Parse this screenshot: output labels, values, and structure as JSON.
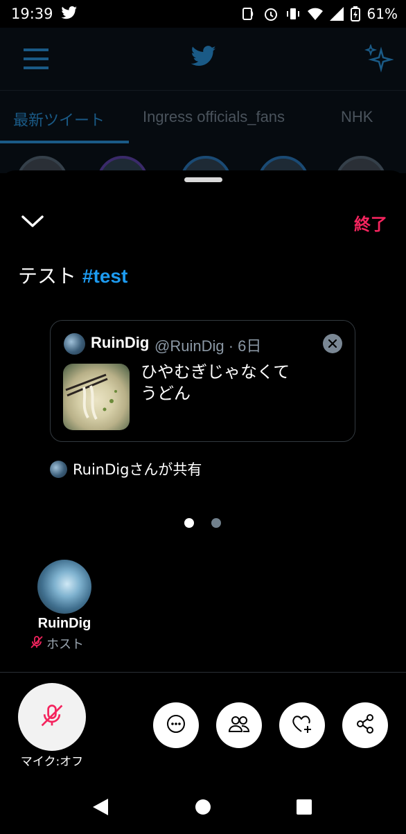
{
  "status_bar": {
    "time": "19:39",
    "battery": "61%"
  },
  "tabs": [
    {
      "label": "最新ツイート",
      "active": true
    },
    {
      "label": "Ingress officials_fans",
      "active": false
    },
    {
      "label": "NHK",
      "active": false
    }
  ],
  "space": {
    "title_text": "テスト",
    "title_hashtag": "#test",
    "end_label": "終了"
  },
  "pinned_tweet": {
    "name": "RuinDig",
    "handle_time": "@RuinDig · 6日",
    "text_line1": "ひやむぎじゃなくて",
    "text_line2": "うどん",
    "shared_by": "RuinDigさんが共有"
  },
  "carousel": {
    "pages": 2,
    "current": 1
  },
  "host": {
    "name": "RuinDig",
    "role": "ホスト"
  },
  "controls": {
    "mic_label": "マイク:オフ"
  },
  "colors": {
    "accent_blue": "#1d9bf0",
    "end_red": "#f4245e"
  }
}
